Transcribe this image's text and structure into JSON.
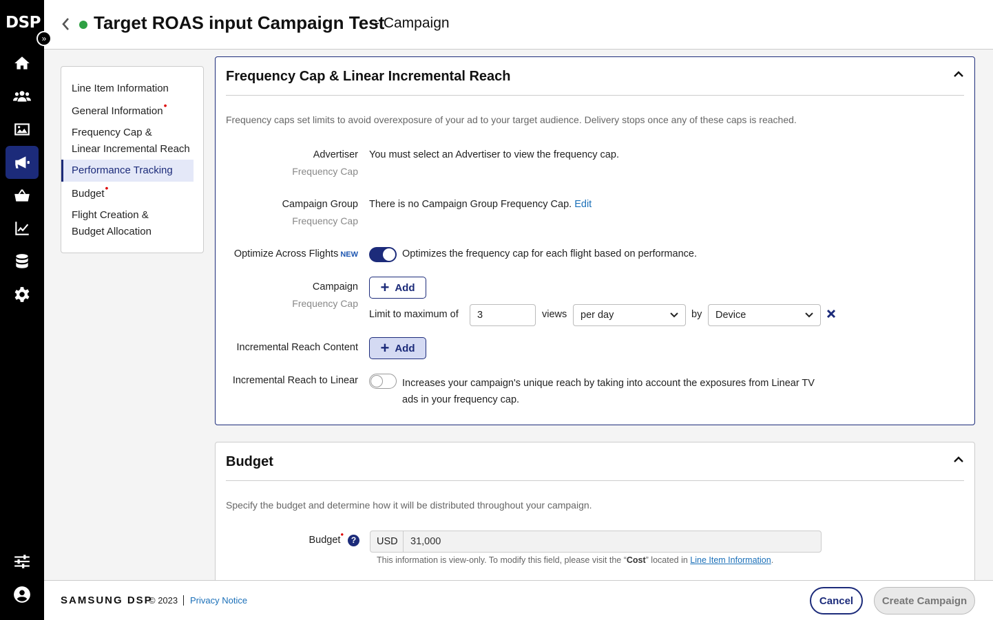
{
  "app": {
    "logo": "DSP",
    "expand_glyph": "»"
  },
  "rail": {
    "items": [
      {
        "icon": "home-icon",
        "active": false
      },
      {
        "icon": "audience-icon",
        "active": false
      },
      {
        "icon": "creative-image-icon",
        "active": false
      },
      {
        "icon": "megaphone-icon",
        "active": true
      },
      {
        "icon": "basket-icon",
        "active": false
      },
      {
        "icon": "reports-chart-icon",
        "active": false
      },
      {
        "icon": "database-icon",
        "active": false
      },
      {
        "icon": "settings-gear-icon",
        "active": false
      },
      {
        "icon": "sliders-icon",
        "active": false
      },
      {
        "icon": "user-account-icon",
        "active": false
      }
    ]
  },
  "header": {
    "status_color": "#2ea043",
    "title": "Target ROAS input Campaign Test",
    "subtitle": "-  Campaign"
  },
  "section_nav": {
    "items": [
      {
        "label": "Line Item Information",
        "required": false,
        "active": false
      },
      {
        "label": "General Information",
        "required": true,
        "active": false
      },
      {
        "label": "Frequency Cap &",
        "label2": "Linear Incremental Reach",
        "required": false,
        "active": false
      },
      {
        "label": "Performance Tracking",
        "required": false,
        "active": true
      },
      {
        "label": "Budget",
        "required": true,
        "active": false
      },
      {
        "label": "Flight Creation &",
        "label2": "Budget Allocation",
        "required": false,
        "active": false
      }
    ],
    "required_marker": "•"
  },
  "freq_panel": {
    "title": "Frequency Cap & Linear Incremental Reach",
    "description": "Frequency caps set limits to avoid overexposure of your ad to your target audience. Delivery stops once any of these caps is reached.",
    "advertiser": {
      "label": "Advertiser",
      "sublabel": "Frequency Cap",
      "value": "You must select an Advertiser to view the frequency cap."
    },
    "campaign_group": {
      "label": "Campaign Group",
      "sublabel": "Frequency Cap",
      "value": "There is no Campaign Group Frequency Cap.",
      "link": "Edit"
    },
    "optimize": {
      "label": "Optimize Across Flights",
      "badge": "NEW",
      "enabled": true,
      "description": "Optimizes the frequency cap for each flight based on performance."
    },
    "campaign": {
      "label": "Campaign",
      "sublabel": "Frequency Cap",
      "add_label": "Add",
      "limit_prefix": "Limit to maximum of",
      "limit_value": "3",
      "views_label": "views",
      "period_selected": "per day",
      "by_label": "by",
      "by_selected": "Device"
    },
    "incremental_content": {
      "label": "Incremental Reach Content",
      "add_label": "Add"
    },
    "incremental_linear": {
      "label": "Incremental Reach to Linear",
      "enabled": false,
      "description_line1": "Increases your campaign's unique reach by taking into account the exposures from Linear TV",
      "description_line2": "ads in your frequency cap."
    }
  },
  "budget_panel": {
    "title": "Budget",
    "description": "Specify the budget and determine how it will be distributed throughout your campaign.",
    "budget_label": "Budget",
    "help_glyph": "?",
    "currency": "USD",
    "amount": "31,000",
    "note_prefix": "This information is view-only. To modify this field, please visit the “",
    "note_bold": "Cost",
    "note_mid": "” located in ",
    "note_link": "Line Item Information",
    "note_suffix": "."
  },
  "footer": {
    "brand": "SAMSUNG DSP",
    "copyright": "© 2023",
    "privacy": "Privacy Notice",
    "cancel": "Cancel",
    "create": "Create Campaign"
  },
  "colors": {
    "accent": "#1c2b7a",
    "link": "#1a6fb8",
    "required": "#d00000",
    "status": "#2ea043"
  }
}
